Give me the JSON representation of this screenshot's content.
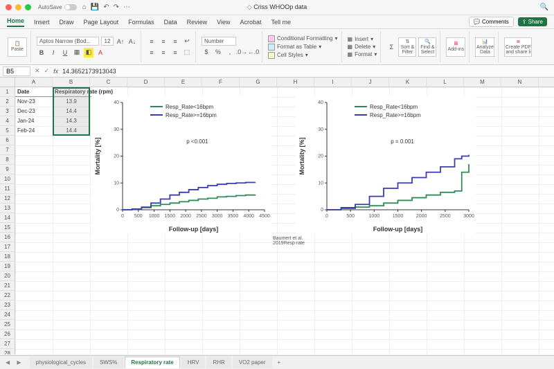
{
  "titlebar": {
    "autosave": "AutoSave",
    "doc_title": "Criss WHOOp data"
  },
  "tabs": [
    "Home",
    "Insert",
    "Draw",
    "Page Layout",
    "Formulas",
    "Data",
    "Review",
    "View",
    "Acrobat",
    "Tell me"
  ],
  "ribbon": {
    "paste": "Paste",
    "font_name": "Aptos Narrow (Bod...",
    "font_size": "12",
    "number_format": "Number",
    "cond_fmt": "Conditional Formatting",
    "fmt_table": "Format as Table",
    "cell_styles": "Cell Styles",
    "insert": "Insert",
    "delete": "Delete",
    "format": "Format",
    "sort": "Sort & Filter",
    "find": "Find & Select",
    "addins": "Add-ins",
    "analyze": "Analyze Data",
    "pdf": "Create PDF and share li"
  },
  "actions": {
    "comments": "Comments",
    "share": "Share"
  },
  "formula_bar": {
    "cell_ref": "B5",
    "formula": "14.3652173913043"
  },
  "columns": [
    "A",
    "B",
    "C",
    "D",
    "E",
    "F",
    "G",
    "H",
    "I",
    "J",
    "K",
    "L",
    "M",
    "N"
  ],
  "table": {
    "header_a": "Date",
    "header_b": "Respiratory rate (rpm)",
    "rows": [
      {
        "a": "Nov-23",
        "b": "13.9"
      },
      {
        "a": "Dec-23",
        "b": "14.4"
      },
      {
        "a": "Jan-24",
        "b": "14.3"
      },
      {
        "a": "Feb-24",
        "b": "14.4"
      }
    ]
  },
  "citation": "Baumert et al. 2019Resp rate",
  "sheets": [
    "physiological_cycles",
    "SWS%",
    "Respiratory rate",
    "HRV",
    "RHR",
    "VO2 paper"
  ],
  "chart_data": [
    {
      "type": "line",
      "xlabel": "Follow-up [days]",
      "ylabel": "Mortality [%]",
      "xlim": [
        0,
        4500
      ],
      "ylim": [
        0,
        40
      ],
      "xticks": [
        0,
        500,
        1000,
        1500,
        2000,
        2500,
        3000,
        3500,
        4000,
        4500
      ],
      "yticks": [
        0,
        10,
        20,
        30,
        40
      ],
      "annotation": "p <0.001",
      "legend": [
        {
          "name": "Resp_Rate<16bpm",
          "color": "#2e8b57"
        },
        {
          "name": "Resp_Rate>=16bpm",
          "color": "#3a3ab5"
        }
      ],
      "series": [
        {
          "name": "Resp_Rate<16bpm",
          "color": "#2e8b57",
          "points": [
            [
              0,
              0
            ],
            [
              300,
              0.2
            ],
            [
              600,
              0.8
            ],
            [
              900,
              1.5
            ],
            [
              1200,
              2.0
            ],
            [
              1500,
              2.5
            ],
            [
              1800,
              3.0
            ],
            [
              2100,
              3.5
            ],
            [
              2400,
              4.0
            ],
            [
              2700,
              4.3
            ],
            [
              3000,
              4.8
            ],
            [
              3300,
              5.0
            ],
            [
              3600,
              5.3
            ],
            [
              3900,
              5.5
            ],
            [
              4200,
              5.7
            ]
          ]
        },
        {
          "name": "Resp_Rate>=16bpm",
          "color": "#3a3ab5",
          "points": [
            [
              0,
              0
            ],
            [
              300,
              0.3
            ],
            [
              600,
              1.0
            ],
            [
              900,
              2.5
            ],
            [
              1200,
              4.0
            ],
            [
              1500,
              5.5
            ],
            [
              1800,
              6.5
            ],
            [
              2100,
              7.5
            ],
            [
              2400,
              8.3
            ],
            [
              2700,
              9.0
            ],
            [
              3000,
              9.5
            ],
            [
              3300,
              9.8
            ],
            [
              3600,
              10.0
            ],
            [
              3900,
              10.2
            ],
            [
              4200,
              10.3
            ]
          ]
        }
      ]
    },
    {
      "type": "line",
      "xlabel": "Follow-up [days]",
      "ylabel": "Mortality [%]",
      "xlim": [
        0,
        3000
      ],
      "ylim": [
        0,
        40
      ],
      "xticks": [
        0,
        500,
        1000,
        1500,
        2000,
        2500,
        3000
      ],
      "yticks": [
        0,
        10,
        20,
        30,
        40
      ],
      "annotation": "p = 0.001",
      "legend": [
        {
          "name": "Resp_Rate<16bpm",
          "color": "#2e8b57"
        },
        {
          "name": "Resp_Rate>=16bpm",
          "color": "#3a3ab5"
        }
      ],
      "series": [
        {
          "name": "Resp_Rate<16bpm",
          "color": "#2e8b57",
          "points": [
            [
              0,
              0
            ],
            [
              300,
              0.5
            ],
            [
              600,
              1.0
            ],
            [
              900,
              1.5
            ],
            [
              1200,
              2.5
            ],
            [
              1500,
              3.5
            ],
            [
              1800,
              4.5
            ],
            [
              2100,
              5.5
            ],
            [
              2400,
              6.5
            ],
            [
              2700,
              7.0
            ],
            [
              2850,
              14.0
            ],
            [
              3000,
              17.0
            ]
          ]
        },
        {
          "name": "Resp_Rate>=16bpm",
          "color": "#3a3ab5",
          "points": [
            [
              0,
              0
            ],
            [
              300,
              0.8
            ],
            [
              600,
              2.0
            ],
            [
              900,
              5.0
            ],
            [
              1200,
              8.0
            ],
            [
              1500,
              10.0
            ],
            [
              1800,
              12.0
            ],
            [
              2100,
              14.0
            ],
            [
              2400,
              16.0
            ],
            [
              2700,
              19.0
            ],
            [
              2850,
              20.0
            ],
            [
              3000,
              20.5
            ]
          ]
        }
      ]
    }
  ]
}
